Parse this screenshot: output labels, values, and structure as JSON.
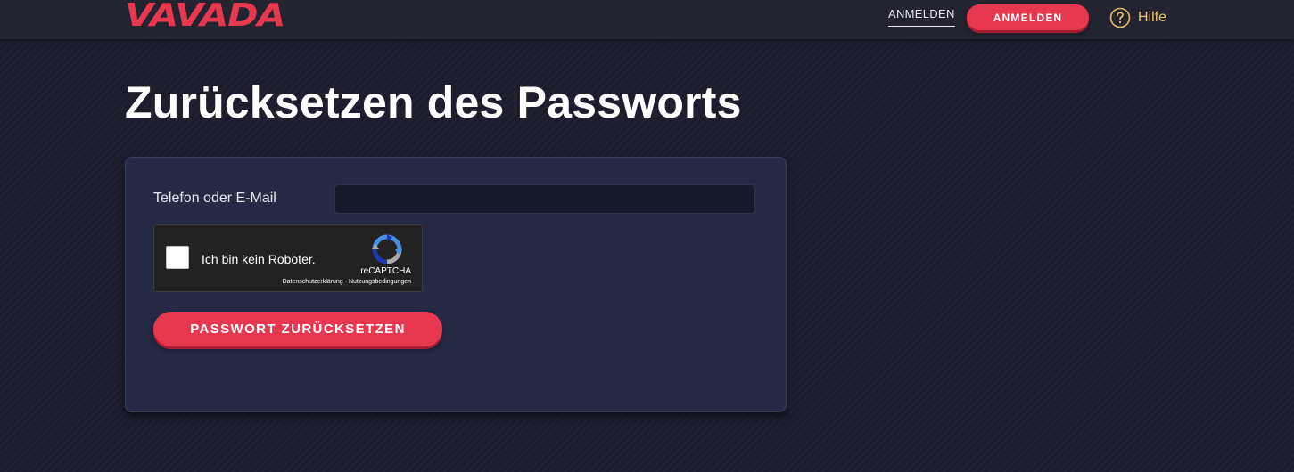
{
  "header": {
    "logo_text": "VAVADA",
    "login_link": "ANMELDEN",
    "login_button": "ANMELDEN",
    "help_label": "Hilfe",
    "help_icon": "question-circle-icon"
  },
  "main": {
    "title": "Zurücksetzen des Passworts",
    "form": {
      "contact_label": "Telefon oder E-Mail",
      "contact_value": "",
      "captcha": {
        "label": "Ich bin kein Roboter.",
        "brand": "reCAPTCHA",
        "privacy": "Datenschutzerklärung",
        "separator": " - ",
        "terms": "Nutzungsbedingungen",
        "icon": "recaptcha-logo-icon"
      },
      "submit_label": "PASSWORT ZURÜCKSETZEN"
    }
  },
  "colors": {
    "accent": "#e8384f",
    "help": "#e9c36b",
    "background": "#1c1c2c",
    "card": "#262a45"
  }
}
